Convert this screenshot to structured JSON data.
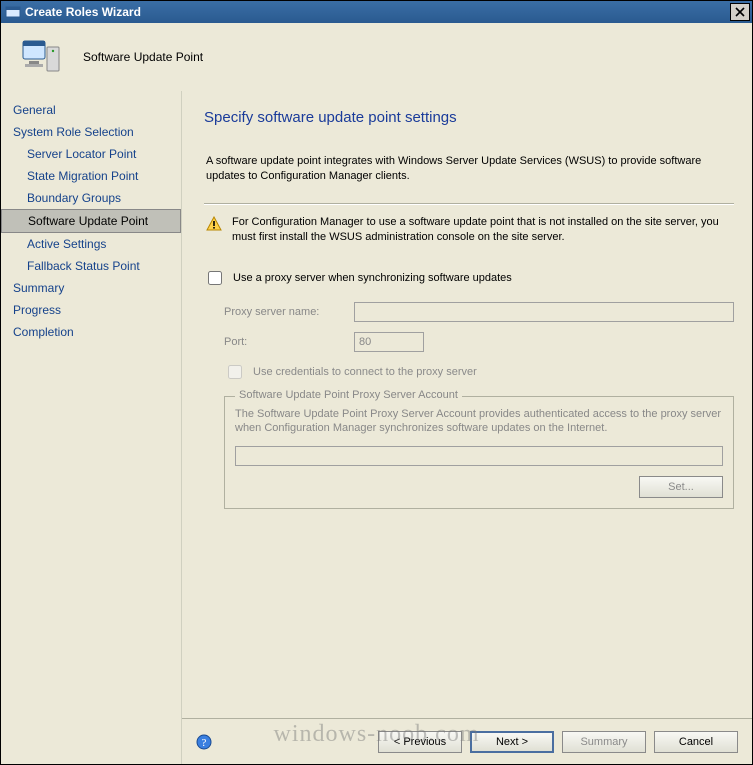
{
  "window": {
    "title": "Create Roles Wizard",
    "close_icon": "close-icon"
  },
  "header": {
    "subtitle": "Software Update Point"
  },
  "sidebar": {
    "items": [
      {
        "label": "General",
        "indent": false,
        "selected": false
      },
      {
        "label": "System Role Selection",
        "indent": false,
        "selected": false
      },
      {
        "label": "Server Locator Point",
        "indent": true,
        "selected": false
      },
      {
        "label": "State Migration Point",
        "indent": true,
        "selected": false
      },
      {
        "label": "Boundary Groups",
        "indent": true,
        "selected": false
      },
      {
        "label": "Software Update Point",
        "indent": true,
        "selected": true
      },
      {
        "label": "Active Settings",
        "indent": true,
        "selected": false
      },
      {
        "label": "Fallback Status Point",
        "indent": true,
        "selected": false
      },
      {
        "label": "Summary",
        "indent": false,
        "selected": false
      },
      {
        "label": "Progress",
        "indent": false,
        "selected": false
      },
      {
        "label": "Completion",
        "indent": false,
        "selected": false
      }
    ]
  },
  "page": {
    "heading": "Specify software update point settings",
    "intro": "A software update point integrates with Windows Server Update Services (WSUS) to provide software updates to Configuration Manager clients.",
    "warning": "For Configuration Manager to use a software update point that is not installed on the site server, you must first install the WSUS administration console on the site server.",
    "use_proxy": {
      "label": "Use a proxy server when synchronizing software updates",
      "checked": false
    },
    "proxy_name": {
      "label": "Proxy server name:",
      "value": ""
    },
    "proxy_port": {
      "label": "Port:",
      "value": "80"
    },
    "use_credentials": {
      "label": "Use credentials to connect to the proxy server",
      "checked": false
    },
    "groupbox": {
      "legend": "Software Update Point Proxy Server Account",
      "desc": "The Software Update Point Proxy Server Account provides authenticated access to the proxy server when Configuration Manager synchronizes software updates on the Internet.",
      "account_value": "",
      "set_label": "Set..."
    }
  },
  "footer": {
    "previous": "< Previous",
    "next": "Next >",
    "summary": "Summary",
    "cancel": "Cancel"
  },
  "watermark": "windows-noob.com"
}
